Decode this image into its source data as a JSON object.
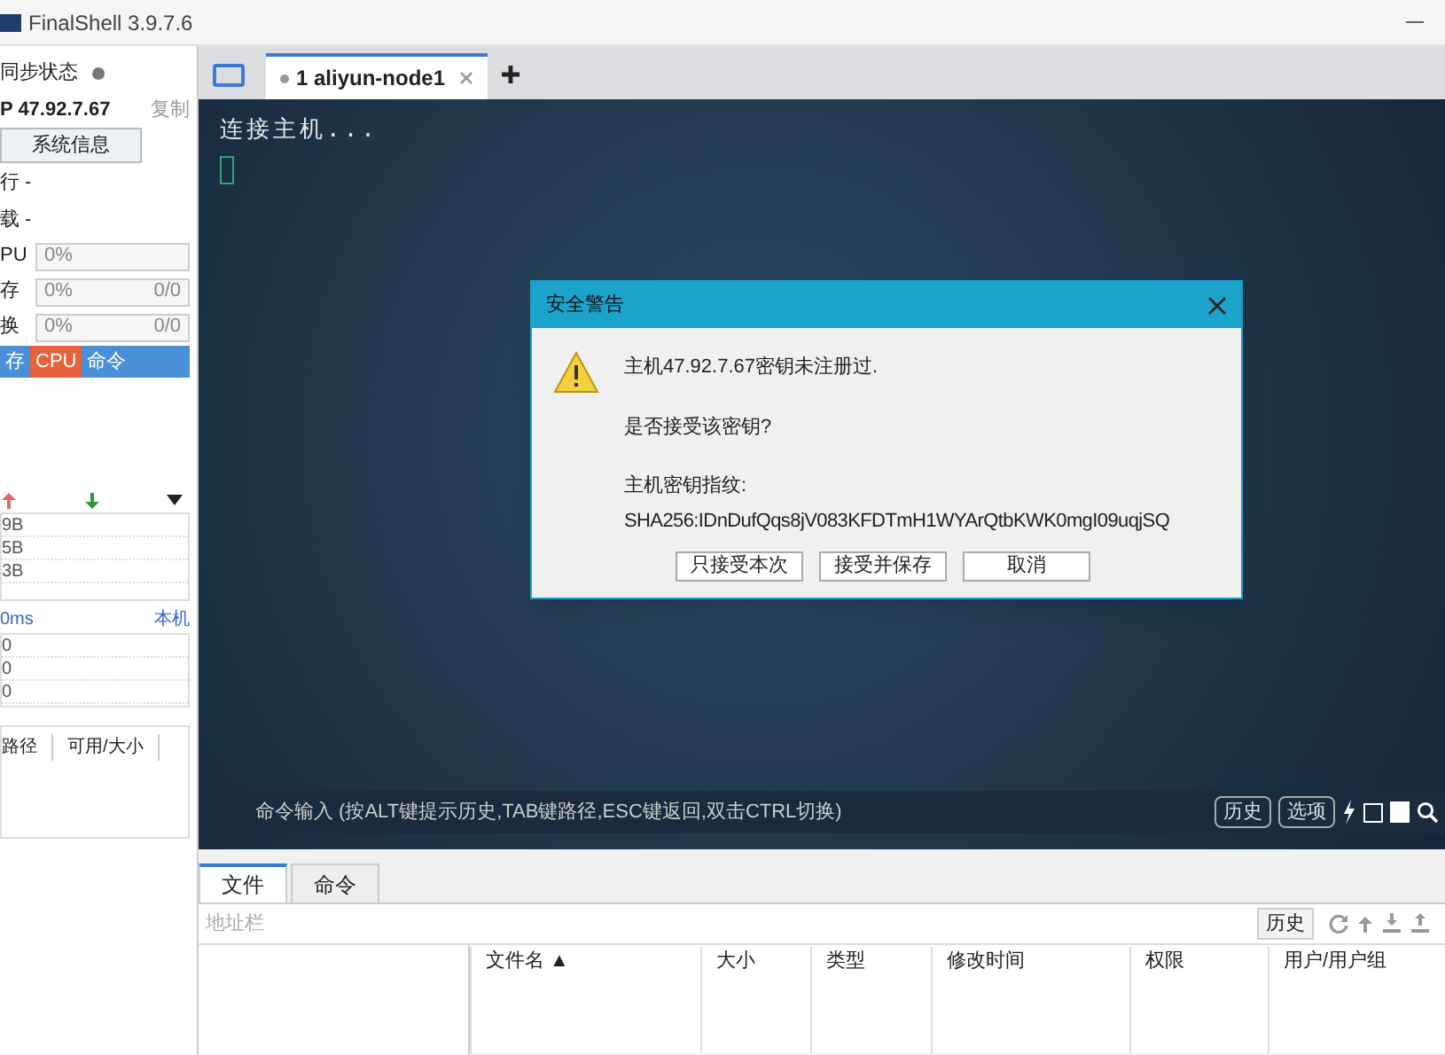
{
  "window": {
    "title": "FinalShell 3.9.7.6"
  },
  "sidebar": {
    "sync_label": "同步状态",
    "ip": "P 47.92.7.67",
    "copy": "复制",
    "sysinfo_button": "系统信息",
    "stats": [
      {
        "label": "行 -"
      },
      {
        "label": "载 -"
      }
    ],
    "meters": [
      {
        "label": "PU",
        "value": "0%"
      },
      {
        "label": "存",
        "value": "0%",
        "extra": "0/0"
      },
      {
        "label": "换",
        "value": "0%",
        "extra": "0/0"
      }
    ],
    "monitor_tabs": [
      {
        "label": "存",
        "selected": false
      },
      {
        "label": "CPU",
        "selected": true
      },
      {
        "label": "命令",
        "selected": false
      }
    ],
    "network": {
      "rows": [
        "9B",
        "5B",
        "3B"
      ]
    },
    "ping": {
      "first": "0ms",
      "host": "本机",
      "rows": [
        "0",
        "0",
        "0"
      ]
    },
    "disk_columns": [
      "路径",
      "可用/大小"
    ]
  },
  "session_tabs": [
    {
      "label": "1 aliyun-node1",
      "selected": true
    }
  ],
  "terminal": {
    "lines": [
      "连接主机..."
    ],
    "command_placeholder": "命令输入 (按ALT键提示历史,TAB键路径,ESC键返回,双击CTRL切换)",
    "buttons": [
      "历史",
      "选项"
    ]
  },
  "dialog": {
    "title": "安全警告",
    "message": "主机47.92.7.67密钥未注册过.",
    "question": "是否接受该密钥?",
    "fingerprint_label": "主机密钥指纹:",
    "fingerprint": "SHA256:IDnDufQqs8jV083KFDTmH1WYArQtbKWK0mgI09uqjSQ",
    "buttons": [
      "只接受本次",
      "接受并保存",
      "取消"
    ]
  },
  "bottom_tabs": [
    {
      "label": "文件",
      "selected": true
    },
    {
      "label": "命令",
      "selected": false
    }
  ],
  "files": {
    "address_placeholder": "地址栏",
    "history_button": "历史",
    "columns": [
      "文件名 ▲",
      "大小",
      "类型",
      "修改时间",
      "权限",
      "用户/用户组"
    ]
  }
}
